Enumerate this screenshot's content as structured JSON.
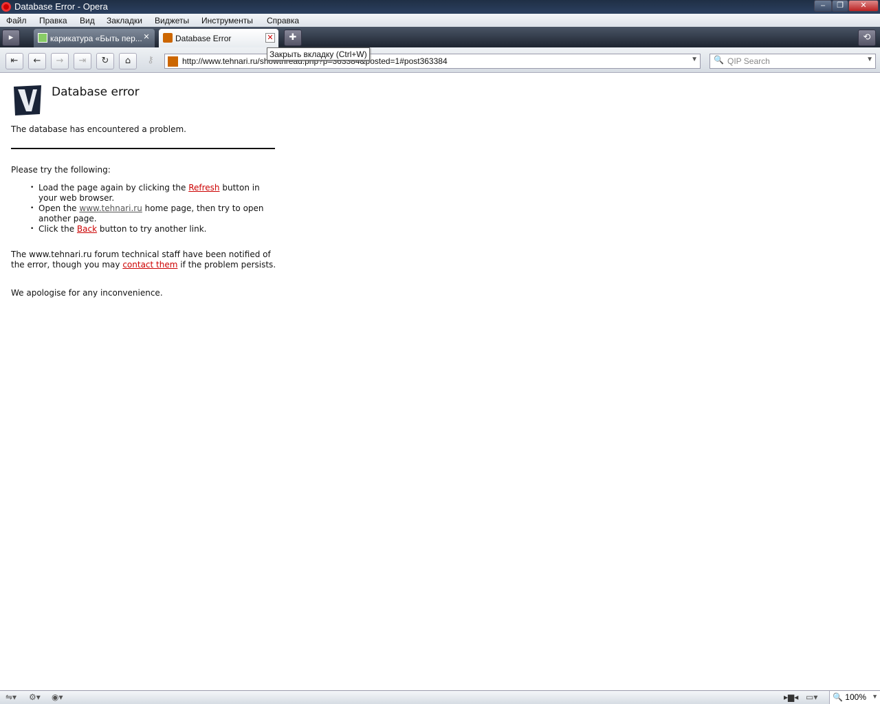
{
  "window": {
    "title": "Database Error - Opera"
  },
  "menu": [
    "Файл",
    "Правка",
    "Вид",
    "Закладки",
    "Виджеты",
    "Инструменты",
    "Справка"
  ],
  "tabs": [
    {
      "label": "карикатура «Быть пер..."
    },
    {
      "label": "Database Error"
    }
  ],
  "tooltip": "Закрыть вкладку (Ctrl+W)",
  "address": "http://www.tehnari.ru/showthread.php?p=363384&posted=1#post363384",
  "search_placeholder": "QIP Search",
  "page": {
    "heading": "Database error",
    "intro": "The database has encountered a problem.",
    "try": "Please try the following:",
    "items": [
      {
        "pre": "Load the page again by clicking the ",
        "link": "Refresh",
        "post": " button in your web browser."
      },
      {
        "pre": "Open the ",
        "link": "www.tehnari.ru",
        "post": " home page, then try to open another page."
      },
      {
        "pre": "Click the ",
        "link": "Back",
        "post": " button to try another link."
      }
    ],
    "notice_pre": "The www.tehnari.ru forum technical staff have been notified of the error, though you may ",
    "notice_link": "contact them",
    "notice_post": " if the problem persists.",
    "apology": "We apologise for any inconvenience."
  },
  "status": {
    "zoom": "100%"
  }
}
